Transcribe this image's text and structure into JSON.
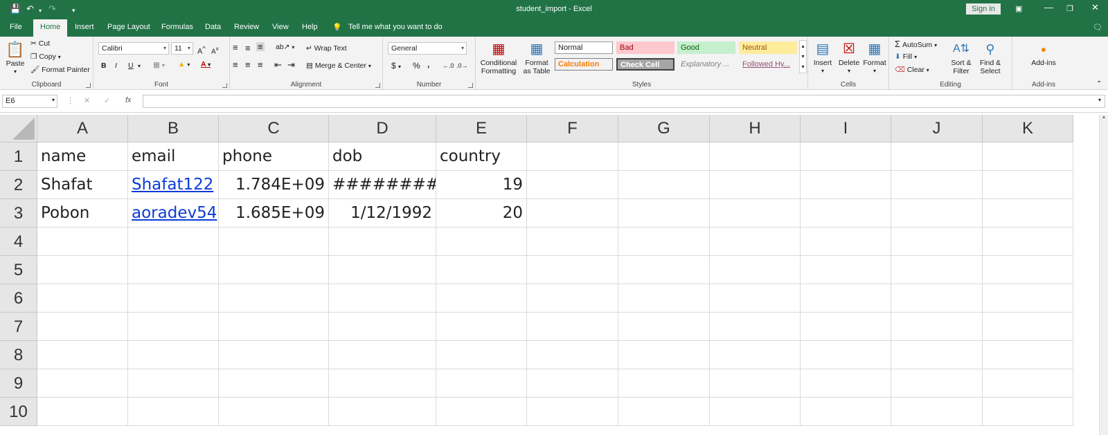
{
  "window": {
    "title": "student_import  -  Excel",
    "sign_in": "Sign in"
  },
  "menu_tabs": [
    "File",
    "Home",
    "Insert",
    "Page Layout",
    "Formulas",
    "Data",
    "Review",
    "View",
    "Help"
  ],
  "tell_me": "Tell me what you want to do",
  "clipboard": {
    "paste": "Paste",
    "cut": "Cut",
    "copy": "Copy",
    "format_painter": "Format Painter",
    "label": "Clipboard"
  },
  "font": {
    "name": "Calibri",
    "size": "11",
    "bold": "B",
    "italic": "I",
    "underline": "U",
    "label": "Font"
  },
  "alignment": {
    "wrap": "Wrap Text",
    "merge": "Merge & Center",
    "label": "Alignment"
  },
  "number": {
    "format": "General",
    "currency": "$",
    "percent": "%",
    "comma": ",",
    "label": "Number"
  },
  "styles": {
    "conditional": "Conditional Formatting",
    "format_table": "Format as Table",
    "cells": [
      "Normal",
      "Bad",
      "Good",
      "Neutral",
      "Calculation",
      "Check Cell",
      "Explanatory ...",
      "Followed Hy..."
    ],
    "label": "Styles"
  },
  "cells_group": {
    "insert": "Insert",
    "delete": "Delete",
    "format": "Format",
    "label": "Cells"
  },
  "editing": {
    "autosum": "AutoSum",
    "fill": "Fill",
    "clear": "Clear",
    "sort": "Sort & Filter",
    "find": "Find & Select",
    "label": "Editing"
  },
  "addins": {
    "btn": "Add-ins",
    "label": "Add-ins"
  },
  "formula_bar": {
    "name_box": "E6",
    "fx": "fx",
    "value": ""
  },
  "columns": [
    "A",
    "B",
    "C",
    "D",
    "E",
    "F",
    "G",
    "H",
    "I",
    "J",
    "K"
  ],
  "rows": [
    "1",
    "2",
    "3",
    "4",
    "5",
    "6",
    "7",
    "8",
    "9",
    "10"
  ],
  "cells": {
    "A1": "name",
    "B1": "email",
    "C1": "phone",
    "D1": "dob",
    "E1": "country",
    "A2": "Shafat",
    "B2": "Shafat122",
    "C2": "1.784E+09",
    "D2": "#########",
    "E2": "19",
    "A3": "Pobon",
    "B3": "aoradev54",
    "C3": "1.685E+09",
    "D3": "1/12/1992",
    "E3": "20"
  },
  "colors": {
    "excel_green": "#217346",
    "link": "#0b3bd6"
  }
}
